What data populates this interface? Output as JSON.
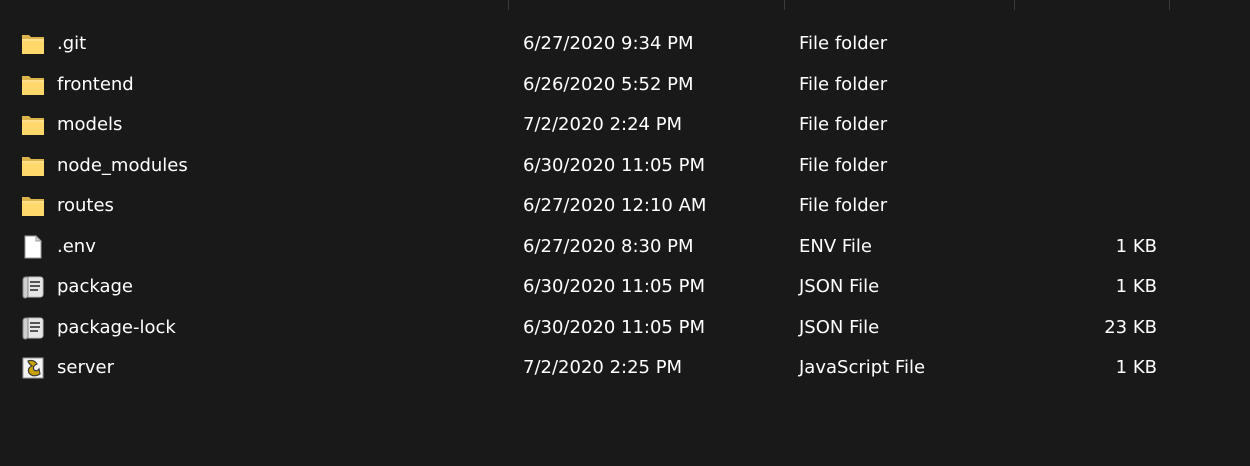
{
  "window": {
    "background": "#191919",
    "text_color": "#ffffff"
  },
  "files": [
    {
      "name": ".git",
      "date_modified": "6/27/2020 9:34 PM",
      "type": "File folder",
      "size": "",
      "icon": "folder-icon"
    },
    {
      "name": "frontend",
      "date_modified": "6/26/2020 5:52 PM",
      "type": "File folder",
      "size": "",
      "icon": "folder-icon"
    },
    {
      "name": "models",
      "date_modified": "7/2/2020 2:24 PM",
      "type": "File folder",
      "size": "",
      "icon": "folder-icon"
    },
    {
      "name": "node_modules",
      "date_modified": "6/30/2020 11:05 PM",
      "type": "File folder",
      "size": "",
      "icon": "folder-icon"
    },
    {
      "name": "routes",
      "date_modified": "6/27/2020 12:10 AM",
      "type": "File folder",
      "size": "",
      "icon": "folder-icon"
    },
    {
      "name": ".env",
      "date_modified": "6/27/2020 8:30 PM",
      "type": "ENV File",
      "size": "1 KB",
      "icon": "blank-file-icon"
    },
    {
      "name": "package",
      "date_modified": "6/30/2020 11:05 PM",
      "type": "JSON File",
      "size": "1 KB",
      "icon": "json-script-icon"
    },
    {
      "name": "package-lock",
      "date_modified": "6/30/2020 11:05 PM",
      "type": "JSON File",
      "size": "23 KB",
      "icon": "json-script-icon"
    },
    {
      "name": "server",
      "date_modified": "7/2/2020 2:25 PM",
      "type": "JavaScript File",
      "size": "1 KB",
      "icon": "javascript-file-icon"
    }
  ]
}
